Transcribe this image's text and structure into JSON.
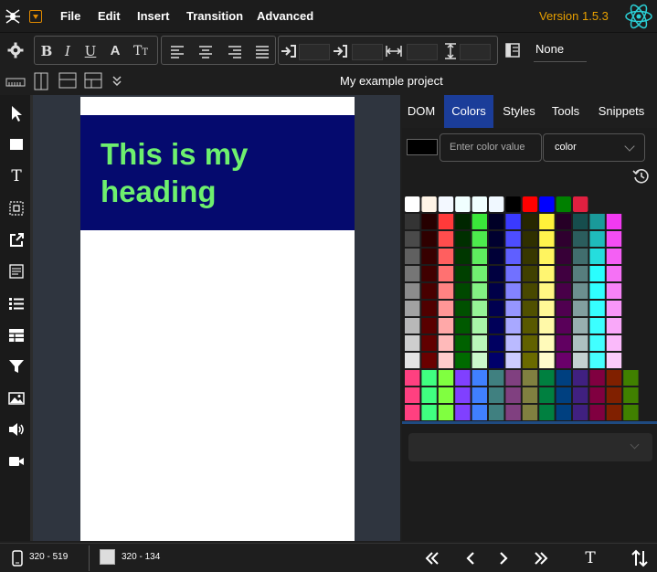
{
  "menu": {
    "items": [
      "File",
      "Edit",
      "Insert",
      "Transition",
      "Advanced"
    ],
    "version": "Version 1.5.3"
  },
  "toolbar": {
    "text_style_buttons": [
      "bold-icon",
      "italic-icon",
      "underline-icon",
      "font-color-icon",
      "font-size-icon"
    ],
    "align_buttons": [
      "align-left-icon",
      "align-center-icon",
      "align-right-icon",
      "align-justify-icon"
    ],
    "spacing_fields": [
      "margin-left-icon",
      "margin-right-icon",
      "letter-spacing-icon",
      "line-height-icon"
    ],
    "layout_value": "None"
  },
  "toolbar2": {
    "project_name": "My example project"
  },
  "tools": [
    "pointer-icon",
    "box-icon",
    "text-icon",
    "grid-icon",
    "link-icon",
    "form-icon",
    "list-icon",
    "table-icon",
    "filter-icon",
    "image-icon",
    "audio-icon",
    "video-icon"
  ],
  "canvas": {
    "heading": "This is my heading",
    "heading_color": "#6ef06e",
    "heading_bg": "#050a6e"
  },
  "panel": {
    "tabs": [
      "DOM",
      "Colors",
      "Styles",
      "Tools",
      "Snippets"
    ],
    "active_tab": "Colors",
    "color_input_placeholder": "Enter color value",
    "color_select_value": "color",
    "current_color": "#000000"
  },
  "status": {
    "viewport_size": "320 - 519",
    "element_size": "320 - 134"
  },
  "colors": {
    "accent": "#1b3d99",
    "version": "#e8a000"
  }
}
